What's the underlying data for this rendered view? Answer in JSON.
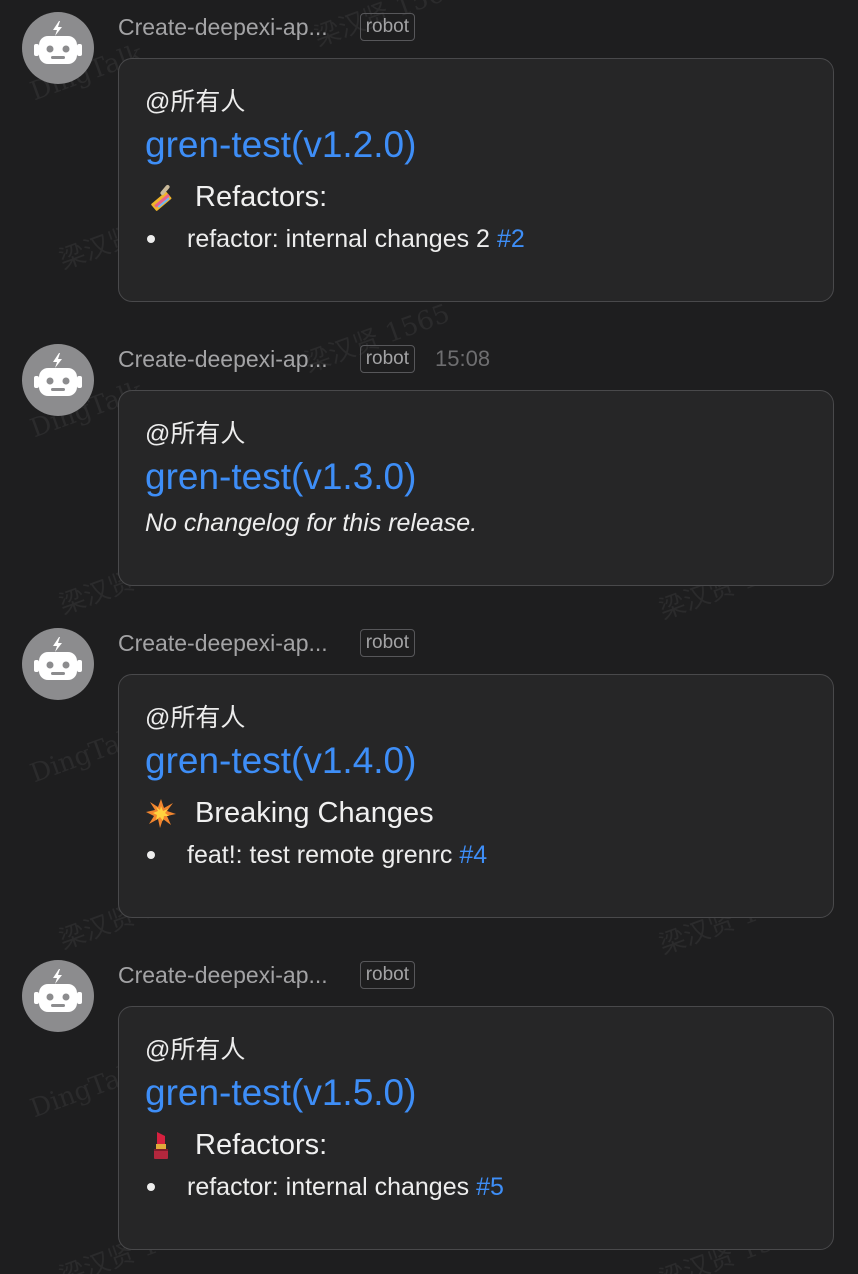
{
  "watermark_text": "梁汉贤 1565",
  "watermark_app": "DingTalk",
  "colors": {
    "background": "#1e1e1f",
    "bubble": "#262627",
    "link": "#3e8ef7",
    "avatar": "#8c8c8e"
  },
  "messages": [
    {
      "sender": "Create-deepexi-ap...",
      "badge": "robot",
      "time": "",
      "mention": "@所有人",
      "title": "gren-test(v1.2.0)",
      "section_icon": "brush-emoji-icon",
      "section_title": "Refactors:",
      "items": [
        {
          "text": "refactor: internal changes 2",
          "link": "#2"
        }
      ]
    },
    {
      "sender": "Create-deepexi-ap...",
      "badge": "robot",
      "time": "15:08",
      "mention": "@所有人",
      "title": "gren-test(v1.3.0)",
      "note": "No changelog for this release."
    },
    {
      "sender": "Create-deepexi-ap...",
      "badge": "robot",
      "time": "",
      "mention": "@所有人",
      "title": "gren-test(v1.4.0)",
      "section_icon": "collision-emoji-icon",
      "section_title": "Breaking Changes",
      "items": [
        {
          "text": "feat!: test remote grenrc",
          "link": "#4"
        }
      ]
    },
    {
      "sender": "Create-deepexi-ap...",
      "badge": "robot",
      "time": "",
      "mention": "@所有人",
      "title": "gren-test(v1.5.0)",
      "section_icon": "lipstick-emoji-icon",
      "section_title": "Refactors:",
      "items": [
        {
          "text": "refactor: internal changes",
          "link": "#5"
        }
      ]
    }
  ]
}
